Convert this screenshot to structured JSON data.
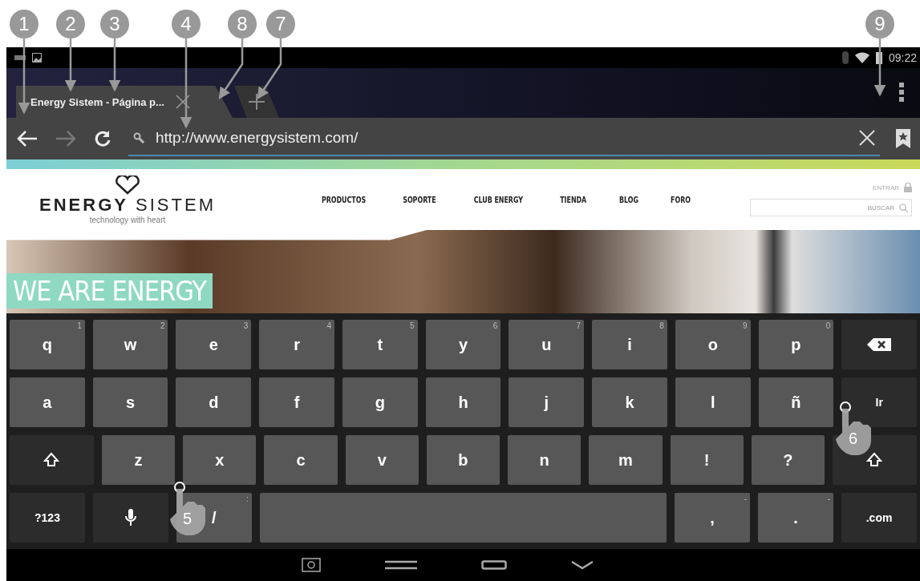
{
  "callouts": [
    {
      "label": "1"
    },
    {
      "label": "2"
    },
    {
      "label": "3"
    },
    {
      "label": "4"
    },
    {
      "label": "8"
    },
    {
      "label": "7"
    },
    {
      "label": "9"
    }
  ],
  "status_bar": {
    "time": "09:22"
  },
  "tabs": [
    {
      "title": "Energy Sistem - Página p...",
      "selected": true
    }
  ],
  "address_bar": {
    "url": "http://www.energysistem.com/"
  },
  "site": {
    "logo": "**ENERGY** SISTEM",
    "tagline": "technology with heart",
    "nav": [
      "PRODUCTOS",
      "SOPORTE",
      "CLUB ENERGY",
      "TIENDA",
      "BLOG",
      "FORO"
    ],
    "login": "ENTRAR",
    "search_placeholder": "BUSCAR",
    "banner": "WE ARE ENERGY"
  },
  "keyboard": {
    "rows": [
      [
        {
          "kind": "char",
          "label": "q",
          "hint": "1"
        },
        {
          "kind": "char",
          "label": "w",
          "hint": "2"
        },
        {
          "kind": "char",
          "label": "e",
          "hint": "3"
        },
        {
          "kind": "char",
          "label": "r",
          "hint": "4"
        },
        {
          "kind": "char",
          "label": "t",
          "hint": "5"
        },
        {
          "kind": "char",
          "label": "y",
          "hint": "6"
        },
        {
          "kind": "char",
          "label": "u",
          "hint": "7"
        },
        {
          "kind": "char",
          "label": "i",
          "hint": "8"
        },
        {
          "kind": "char",
          "label": "o",
          "hint": "9"
        },
        {
          "kind": "char",
          "label": "p",
          "hint": "0"
        },
        {
          "kind": "backspace"
        }
      ],
      [
        {
          "kind": "char",
          "label": "a"
        },
        {
          "kind": "char",
          "label": "s"
        },
        {
          "kind": "char",
          "label": "d"
        },
        {
          "kind": "char",
          "label": "f"
        },
        {
          "kind": "char",
          "label": "g"
        },
        {
          "kind": "char",
          "label": "h"
        },
        {
          "kind": "char",
          "label": "j"
        },
        {
          "kind": "char",
          "label": "k"
        },
        {
          "kind": "char",
          "label": "l"
        },
        {
          "kind": "char",
          "label": "ñ"
        },
        {
          "kind": "enter",
          "label": "Ir"
        }
      ],
      [
        {
          "kind": "shift"
        },
        {
          "kind": "char",
          "label": "z"
        },
        {
          "kind": "char",
          "label": "x"
        },
        {
          "kind": "char",
          "label": "c"
        },
        {
          "kind": "char",
          "label": "v"
        },
        {
          "kind": "char",
          "label": "b"
        },
        {
          "kind": "char",
          "label": "n"
        },
        {
          "kind": "char",
          "label": "m"
        },
        {
          "kind": "char",
          "label": "!"
        },
        {
          "kind": "char",
          "label": "?"
        },
        {
          "kind": "shift"
        }
      ]
    ],
    "bottom_row": [
      {
        "kind": "mode",
        "label": "?123"
      },
      {
        "kind": "mic"
      },
      {
        "kind": "char",
        "label": "/",
        "hint": ":"
      },
      {
        "kind": "space"
      },
      {
        "kind": "char",
        "label": ",",
        "hint": "-"
      },
      {
        "kind": "char",
        "label": ".",
        "hint": "-"
      },
      {
        "kind": "mode",
        "label": ".com"
      }
    ]
  },
  "touch_points": [
    {
      "label": "5"
    },
    {
      "label": "6"
    }
  ]
}
